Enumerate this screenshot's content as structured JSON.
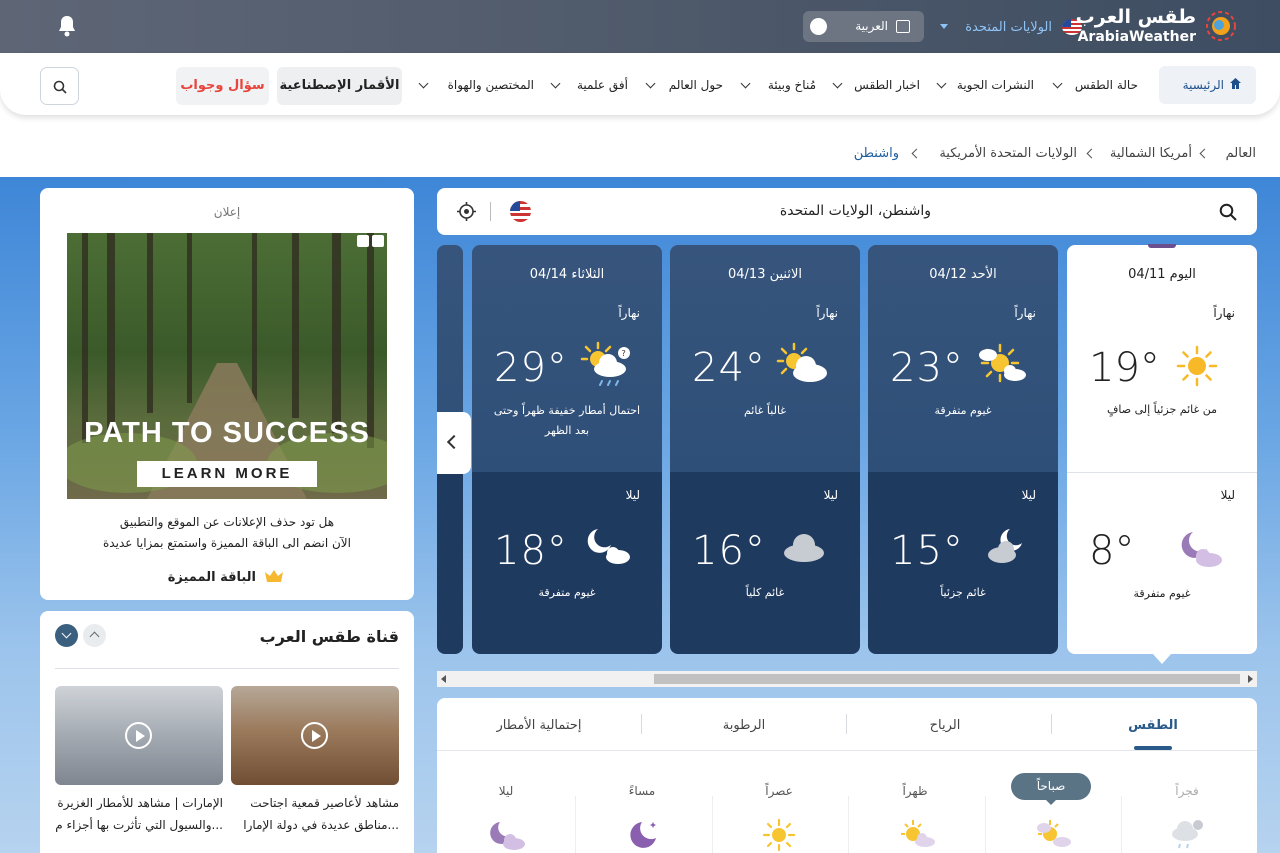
{
  "header": {
    "logo_ar": "طقس العرب",
    "logo_en": "ArabiaWeather",
    "country": "الولايات المتحدة",
    "language": "العربية"
  },
  "nav": {
    "items": [
      {
        "label": "الرئيسية"
      },
      {
        "label": "حالة الطقس"
      },
      {
        "label": "النشرات الجوية"
      },
      {
        "label": "اخبار الطقس"
      },
      {
        "label": "مُناخ وبيئة"
      },
      {
        "label": "حول العالم"
      },
      {
        "label": "أفق علمية"
      },
      {
        "label": "المختصين والهواة"
      }
    ],
    "satellite": "الأقمار الإصطناعية",
    "qa": "سؤال وجواب"
  },
  "breadcrumb": [
    "العالم",
    "أمريكا الشمالية",
    "الولايات المتحدة الأمريكية",
    "واشنطن"
  ],
  "search": {
    "location": "واشنطن، الولايات المتحدة"
  },
  "forecast": [
    {
      "date": "اليوم 04/11",
      "day_label": "نهاراً",
      "day_temp": "19°",
      "day_desc": "من غائم جزئياً إلى صافٍ",
      "night_label": "ليلا",
      "night_temp": "8°",
      "night_desc": "غيوم متفرقة"
    },
    {
      "date": "الأحد 04/12",
      "day_label": "نهاراً",
      "day_temp": "23°",
      "day_desc": "غيوم متفرقة",
      "night_label": "ليلا",
      "night_temp": "15°",
      "night_desc": "غائم جزئياً"
    },
    {
      "date": "الاثنين 04/13",
      "day_label": "نهاراً",
      "day_temp": "24°",
      "day_desc": "غالباً غائم",
      "night_label": "ليلا",
      "night_temp": "16°",
      "night_desc": "غائم كلياً"
    },
    {
      "date": "الثلاثاء 04/14",
      "day_label": "نهاراً",
      "day_temp": "29°",
      "day_desc1": "احتمال أمطار خفيفة ظهراً وحتى",
      "day_desc2": "بعد الظهر",
      "night_label": "ليلا",
      "night_temp": "18°",
      "night_desc": "غيوم متفرقة"
    }
  ],
  "tabs": [
    "الطقس",
    "الرياح",
    "الرطوبة",
    "إحتمالية الأمطار"
  ],
  "time_slots": [
    "فجراً",
    "صباحاً",
    "ظهراً",
    "عصراً",
    "مساءً",
    "ليلا"
  ],
  "ad": {
    "label": "إعلان",
    "headline": "PATH TO SUCCESS",
    "cta": "LEARN MORE",
    "promo_line1": "هل تود حذف الإعلانات عن الموقع والتطبيق",
    "promo_line2": "الآن انضم الى الباقة المميزة واستمتع بمزايا عديدة",
    "premium": "الباقة المميزة"
  },
  "channel": {
    "title": "قناة طقس العرب",
    "videos": [
      {
        "line1": "مشاهد لأعاصير قمعية اجتاحت",
        "line2": "مناطق عديدة في دولة الإمارا..."
      },
      {
        "line1": "الإمارات | مشاهد للأمطار الغزيرة",
        "line2": "والسيول التي تأثرت بها أجزاء م..."
      }
    ]
  },
  "colors": {
    "nav_active_bg": "#eef2f6",
    "qa_red": "#e8453c",
    "card_day": "#2e4f78",
    "card_night": "#1f3a5f",
    "tab_accent": "#2a5a8a"
  }
}
